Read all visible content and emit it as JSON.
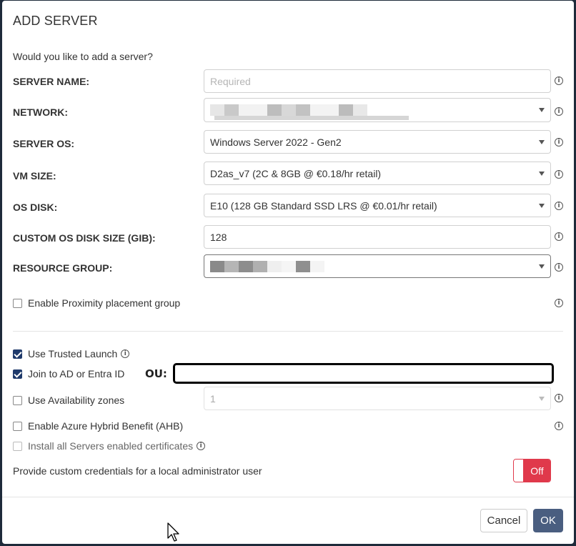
{
  "dialog": {
    "title": "ADD SERVER",
    "intro": "Would you like to add a server?"
  },
  "fields": {
    "server_name": {
      "label": "SERVER NAME:",
      "value": "",
      "placeholder": "Required"
    },
    "network": {
      "label": "NETWORK:",
      "value": ""
    },
    "server_os": {
      "label": "SERVER OS:",
      "value": "Windows Server 2022 - Gen2"
    },
    "vm_size": {
      "label": "VM SIZE:",
      "value": "D2as_v7 (2C & 8GB @ €0.18/hr retail)"
    },
    "os_disk": {
      "label": "OS DISK:",
      "value": "E10 (128 GB Standard SSD LRS @ €0.01/hr retail)"
    },
    "custom_disk_size": {
      "label": "CUSTOM OS DISK SIZE (GIB):",
      "value": "128"
    },
    "resource_group": {
      "label": "RESOURCE GROUP:",
      "value": ""
    }
  },
  "options": {
    "proximity": {
      "label": "Enable Proximity placement group",
      "checked": false
    },
    "trusted_launch": {
      "label": "Use Trusted Launch",
      "checked": true
    },
    "join_ad": {
      "label": "Join to AD or Entra ID",
      "checked": true
    },
    "ou_label": "OU:",
    "availability_zones": {
      "label": "Use Availability zones",
      "checked": false,
      "zone_value": "1"
    },
    "ahb": {
      "label": "Enable Azure Hybrid Benefit (AHB)",
      "checked": false
    },
    "certificates": {
      "label": "Install all Servers enabled certificates",
      "checked": false
    },
    "custom_credentials": {
      "label": "Provide custom credentials for a local administrator user",
      "toggle_state": "Off"
    }
  },
  "info_glyph": "i",
  "buttons": {
    "cancel": "Cancel",
    "ok": "OK"
  },
  "colors": {
    "toggle_off": "#e0394b",
    "ok_button": "#4a5e80",
    "checkbox_checked": "#1f3a6b"
  }
}
